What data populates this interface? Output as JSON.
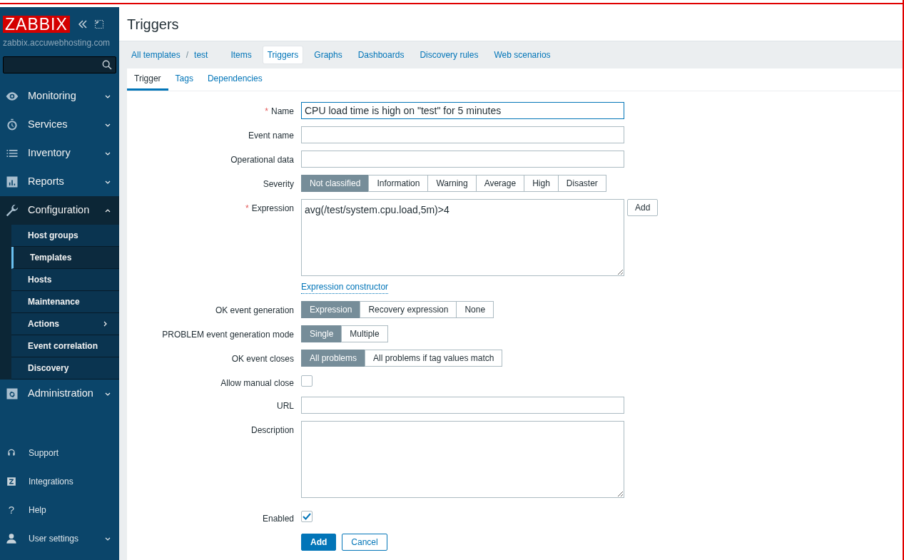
{
  "sidebar": {
    "logo": "ZABBIX",
    "server": "zabbix.accuwebhosting.com",
    "menu": [
      {
        "label": "Monitoring",
        "expanded": false
      },
      {
        "label": "Services",
        "expanded": false
      },
      {
        "label": "Inventory",
        "expanded": false
      },
      {
        "label": "Reports",
        "expanded": false
      },
      {
        "label": "Configuration",
        "expanded": true,
        "children": [
          {
            "label": "Host groups",
            "selected": false,
            "submenu": false
          },
          {
            "label": "Templates",
            "selected": true,
            "submenu": false
          },
          {
            "label": "Hosts",
            "selected": false,
            "submenu": false
          },
          {
            "label": "Maintenance",
            "selected": false,
            "submenu": false
          },
          {
            "label": "Actions",
            "selected": false,
            "submenu": true
          },
          {
            "label": "Event correlation",
            "selected": false,
            "submenu": false
          },
          {
            "label": "Discovery",
            "selected": false,
            "submenu": false
          }
        ]
      },
      {
        "label": "Administration",
        "expanded": false
      }
    ],
    "footer": [
      {
        "label": "Support",
        "dropdown": false
      },
      {
        "label": "Integrations",
        "dropdown": false
      },
      {
        "label": "Help",
        "glyph": "?",
        "dropdown": false
      },
      {
        "label": "User settings",
        "dropdown": true
      }
    ]
  },
  "page_title": "Triggers",
  "breadcrumbs": [
    {
      "label": "All templates"
    },
    {
      "separator": "/",
      "label": "test"
    }
  ],
  "nav_tabs": [
    {
      "label": "Items",
      "selected": false
    },
    {
      "label": "Triggers",
      "selected": true
    },
    {
      "label": "Graphs",
      "selected": false
    },
    {
      "label": "Dashboards",
      "selected": false
    },
    {
      "label": "Discovery rules",
      "selected": false
    },
    {
      "label": "Web scenarios",
      "selected": false
    }
  ],
  "form_tabs": [
    {
      "label": "Trigger",
      "selected": true
    },
    {
      "label": "Tags",
      "selected": false
    },
    {
      "label": "Dependencies",
      "selected": false
    }
  ],
  "form": [
    {
      "kind": "text",
      "label": "Name",
      "required_mark": "*",
      "value": "CPU load time is high on \"test\" for 5 minutes",
      "focused": true
    },
    {
      "kind": "text",
      "label": "Event name",
      "focused": false
    },
    {
      "kind": "text",
      "label": "Operational data",
      "focused": false
    },
    {
      "kind": "segmented",
      "label": "Severity",
      "options": [
        {
          "label": "Not classified",
          "selected": true
        },
        {
          "label": "Information",
          "selected": false
        },
        {
          "label": "Warning",
          "selected": false
        },
        {
          "label": "Average",
          "selected": false
        },
        {
          "label": "High",
          "selected": false
        },
        {
          "label": "Disaster",
          "selected": false
        }
      ]
    },
    {
      "kind": "expression",
      "label": "Expression",
      "required_mark": "*",
      "value": "avg(/test/system.cpu.load,5m)>4",
      "button": "Add",
      "link": "Expression constructor"
    },
    {
      "kind": "segmented",
      "label": "OK event generation",
      "options": [
        {
          "label": "Expression",
          "selected": true
        },
        {
          "label": "Recovery expression",
          "selected": false
        },
        {
          "label": "None",
          "selected": false
        }
      ]
    },
    {
      "kind": "segmented",
      "label": "PROBLEM event generation mode",
      "options": [
        {
          "label": "Single",
          "selected": true
        },
        {
          "label": "Multiple",
          "selected": false
        }
      ]
    },
    {
      "kind": "segmented",
      "label": "OK event closes",
      "options": [
        {
          "label": "All problems",
          "selected": true
        },
        {
          "label": "All problems if tag values match",
          "selected": false
        }
      ]
    },
    {
      "kind": "checkbox",
      "label": "Allow manual close",
      "checked": false
    },
    {
      "kind": "text",
      "label": "URL",
      "focused": false
    },
    {
      "kind": "textarea",
      "label": "Description"
    },
    {
      "kind": "checkbox",
      "label": "Enabled",
      "checked": true
    }
  ],
  "actions": [
    {
      "label": "Add",
      "primary": true
    },
    {
      "label": "Cancel",
      "primary": false
    }
  ]
}
